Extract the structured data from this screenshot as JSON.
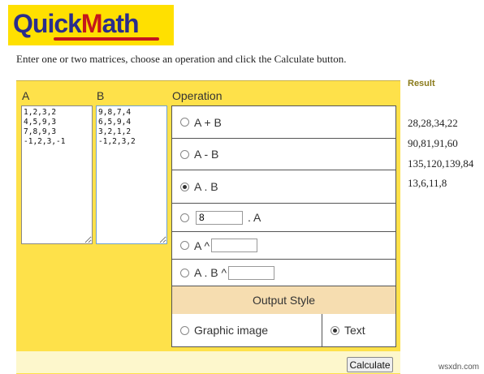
{
  "logo": {
    "part1": "Q",
    "part2": "uick",
    "part3": "M",
    "part4": "ath"
  },
  "intro": "Enter one or two matrices, choose an operation and click the Calculate button.",
  "matrix_a": {
    "label": "A",
    "value": "1,2,3,2\n4,5,9,3\n7,8,9,3\n-1,2,3,-1"
  },
  "matrix_b": {
    "label": "B",
    "value": "9,8,7,4\n6,5,9,4\n3,2,1,2\n-1,2,3,2"
  },
  "operation": {
    "label": "Operation",
    "options": [
      {
        "label": "A + B",
        "checked": false
      },
      {
        "label": "A - B",
        "checked": false
      },
      {
        "label": "A . B",
        "checked": true
      },
      {
        "label": ". A",
        "checked": false,
        "input": "8"
      },
      {
        "label": "A ^",
        "checked": false,
        "input": ""
      },
      {
        "label": "A . B ^",
        "checked": false,
        "input": ""
      }
    ]
  },
  "output_style": {
    "label": "Output Style",
    "graphic_label": "Graphic image",
    "text_label": "Text",
    "selected": "text"
  },
  "calculate_label": "Calculate",
  "result": {
    "title": "Result",
    "lines": [
      "28,28,34,22",
      "90,81,91,60",
      "135,120,139,84",
      "13,6,11,8"
    ]
  },
  "watermark": "wsxdn.com"
}
